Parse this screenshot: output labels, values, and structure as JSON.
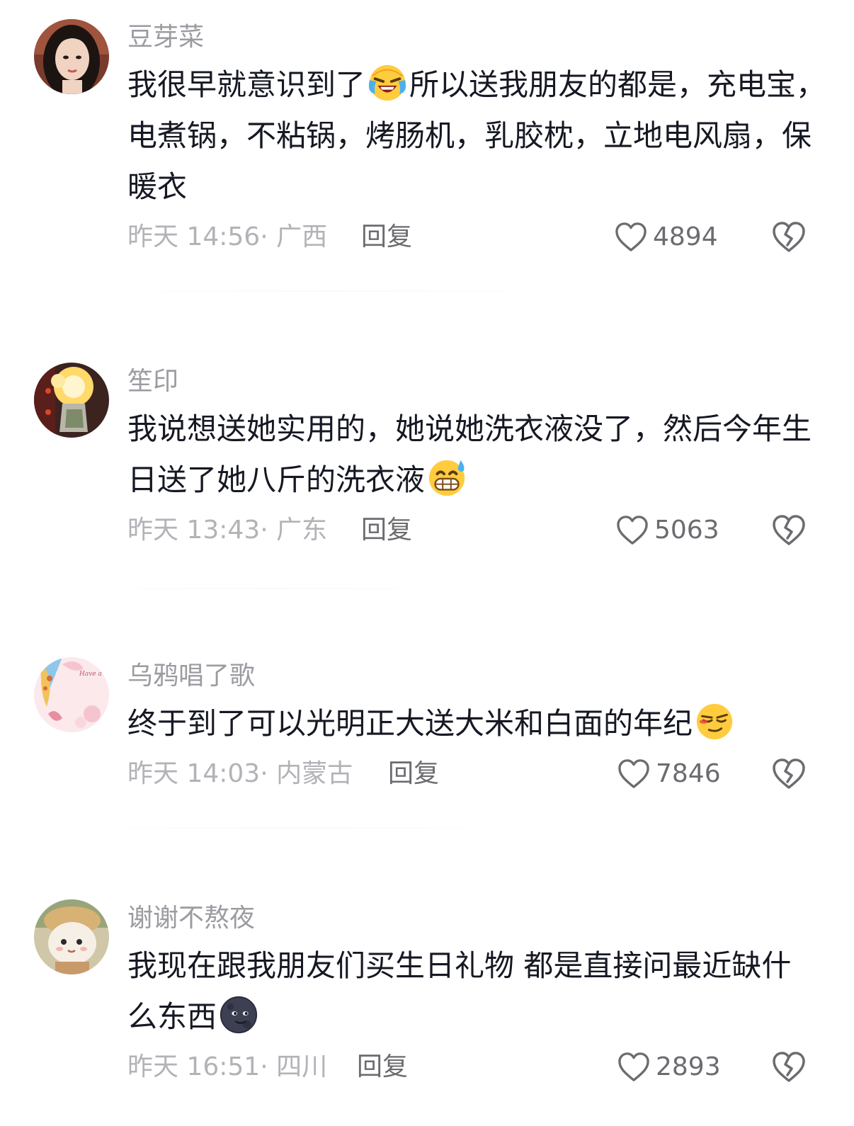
{
  "comments": [
    {
      "username": "豆芽菜",
      "avatar_icon": "girl-portrait-avatar",
      "text_1": "我很早就意识到了",
      "emoji_1": "laughing-crying-face-icon",
      "text_2": "所以送我朋友的都是，充电宝，电煮锅，不粘锅，烤肠机，乳胶枕，立地电风扇，保暖衣",
      "time": "昨天 14:56· 广西",
      "reply_label": "回复",
      "likes": "4894"
    },
    {
      "username": "笙印",
      "avatar_icon": "sparkler-photo-avatar",
      "text_1": "我说想送她实用的，她说她洗衣液没了，然后今年生日送了她八斤的洗衣液",
      "emoji_1": "grinning-sweat-face-icon",
      "time": "昨天 13:43· 广东",
      "reply_label": "回复",
      "likes": "5063"
    },
    {
      "username": "乌鸦唱了歌",
      "avatar_icon": "pink-cartoon-avatar",
      "text_1": "终于到了可以光明正大送大米和白面的年纪",
      "emoji_1": "smug-face-icon",
      "time": "昨天 14:03· 内蒙古",
      "reply_label": "回复",
      "likes": "7846"
    },
    {
      "username": "谢谢不熬夜",
      "avatar_icon": "plush-doll-avatar",
      "text_1": "我现在跟我朋友们买生日礼物 都是直接问最近缺什么东西",
      "emoji_1": "new-moon-face-icon",
      "time": "昨天 16:51· 四川",
      "reply_label": "回复",
      "likes": "2893"
    }
  ],
  "avatar_text": "Have a nice day",
  "colors": {
    "username": "#9b9ba1",
    "content": "#161823",
    "meta": "#b2b2b7",
    "action": "#6b6b70"
  }
}
